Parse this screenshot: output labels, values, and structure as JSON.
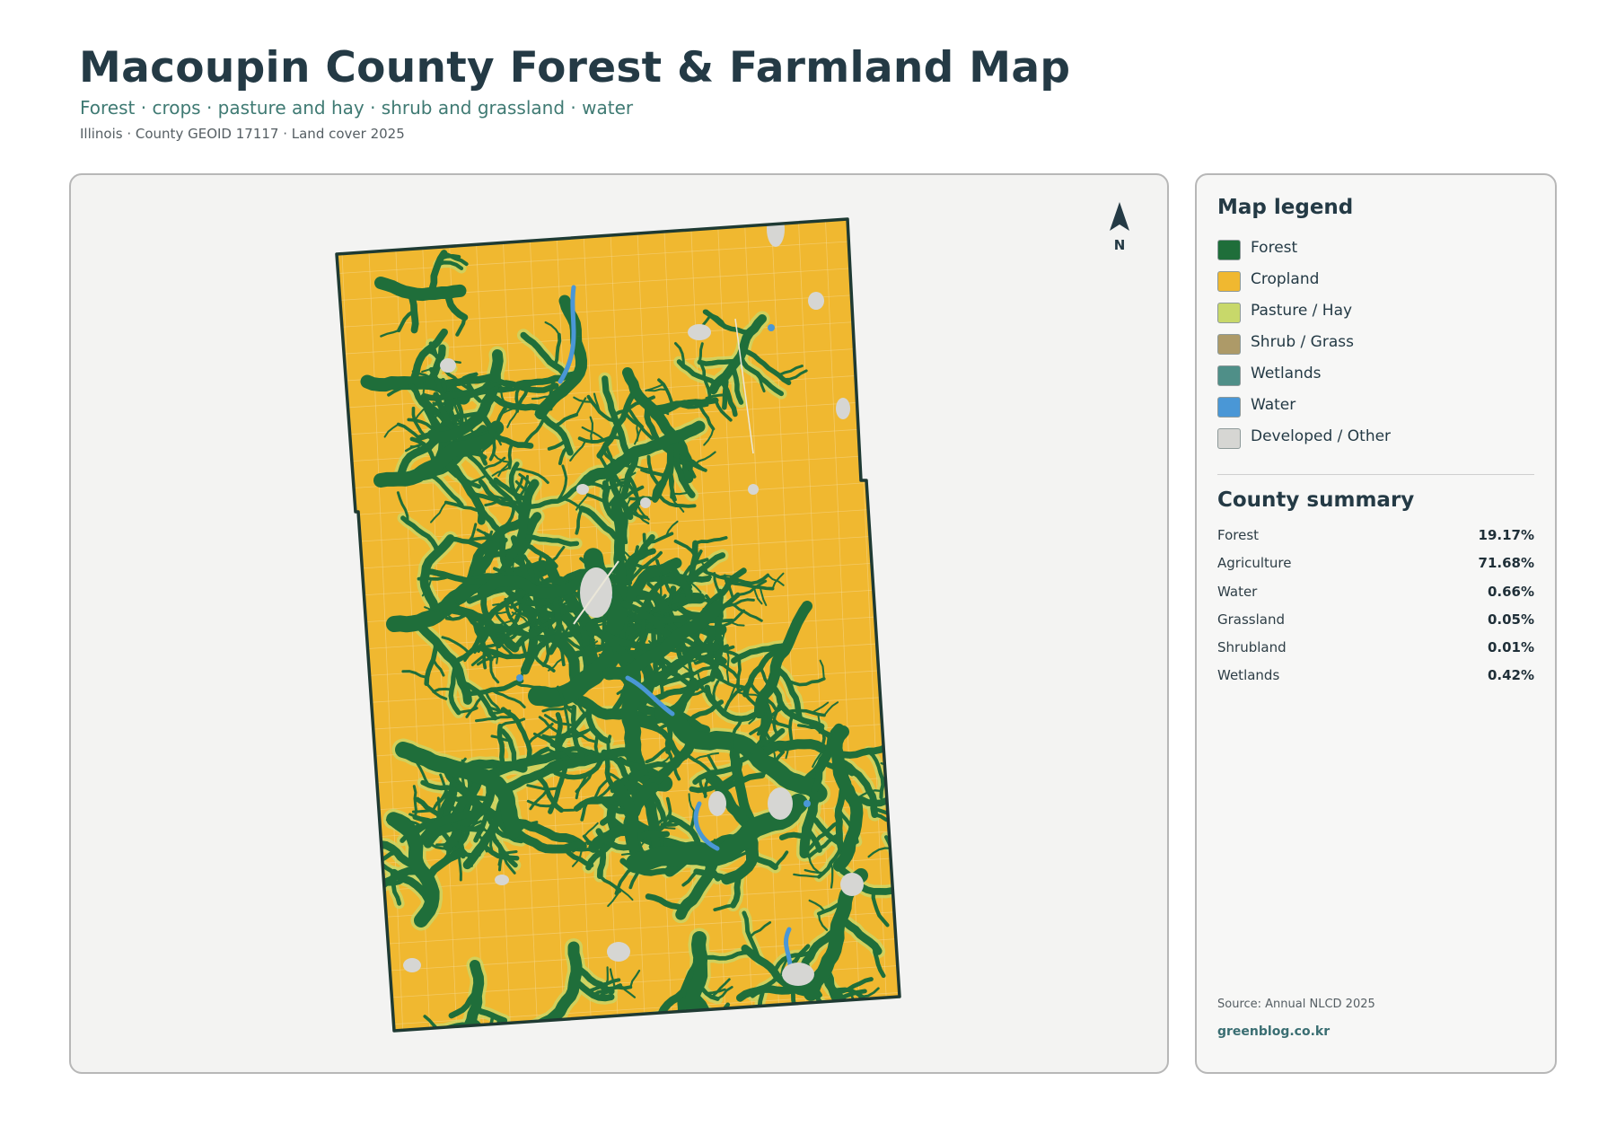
{
  "header": {
    "title": "Macoupin County Forest & Farmland Map",
    "subtitle": "Forest · crops · pasture and hay · shrub and grassland · water",
    "meta": "Illinois · County GEOID 17117 · Land cover 2025"
  },
  "map": {
    "north_label": "N",
    "colors": {
      "forest": "#1f6e3a",
      "cropland": "#f0b830",
      "pasture": "#c8d86a",
      "shrub": "#ad9a68",
      "wetlands": "#4f8f88",
      "water": "#4a97d6",
      "developed": "#d6d6d3",
      "outline": "#1e3a33",
      "background": "#f3f3f2"
    }
  },
  "legend": {
    "title": "Map legend",
    "items": [
      {
        "label": "Forest",
        "color": "#1f6e3a"
      },
      {
        "label": "Cropland",
        "color": "#f0b830"
      },
      {
        "label": "Pasture / Hay",
        "color": "#c8d86a"
      },
      {
        "label": "Shrub / Grass",
        "color": "#ad9a68"
      },
      {
        "label": "Wetlands",
        "color": "#4f8f88"
      },
      {
        "label": "Water",
        "color": "#4a97d6"
      },
      {
        "label": "Developed / Other",
        "color": "#d6d6d3"
      }
    ]
  },
  "summary": {
    "title": "County summary",
    "rows": [
      {
        "label": "Forest",
        "value": "19.17%"
      },
      {
        "label": "Agriculture",
        "value": "71.68%"
      },
      {
        "label": "Water",
        "value": "0.66%"
      },
      {
        "label": "Grassland",
        "value": "0.05%"
      },
      {
        "label": "Shrubland",
        "value": "0.01%"
      },
      {
        "label": "Wetlands",
        "value": "0.42%"
      }
    ]
  },
  "footer": {
    "source": "Source: Annual NLCD 2025",
    "brand": "greenblog.co.kr"
  }
}
